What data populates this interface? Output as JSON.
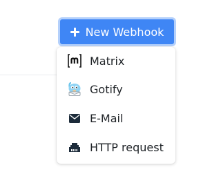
{
  "header": {
    "new_webhook_label": "New Webhook"
  },
  "menu": {
    "items": [
      {
        "label": "Matrix",
        "icon": "matrix-logo-icon"
      },
      {
        "label": "Gotify",
        "icon": "gotify-logo-icon"
      },
      {
        "label": "E-Mail",
        "icon": "envelope-icon"
      },
      {
        "label": "HTTP request",
        "icon": "ethernet-icon"
      }
    ]
  },
  "colors": {
    "accent": "#3f86f5",
    "accent_focus_ring": "#b4d0fb",
    "text": "#212529"
  }
}
